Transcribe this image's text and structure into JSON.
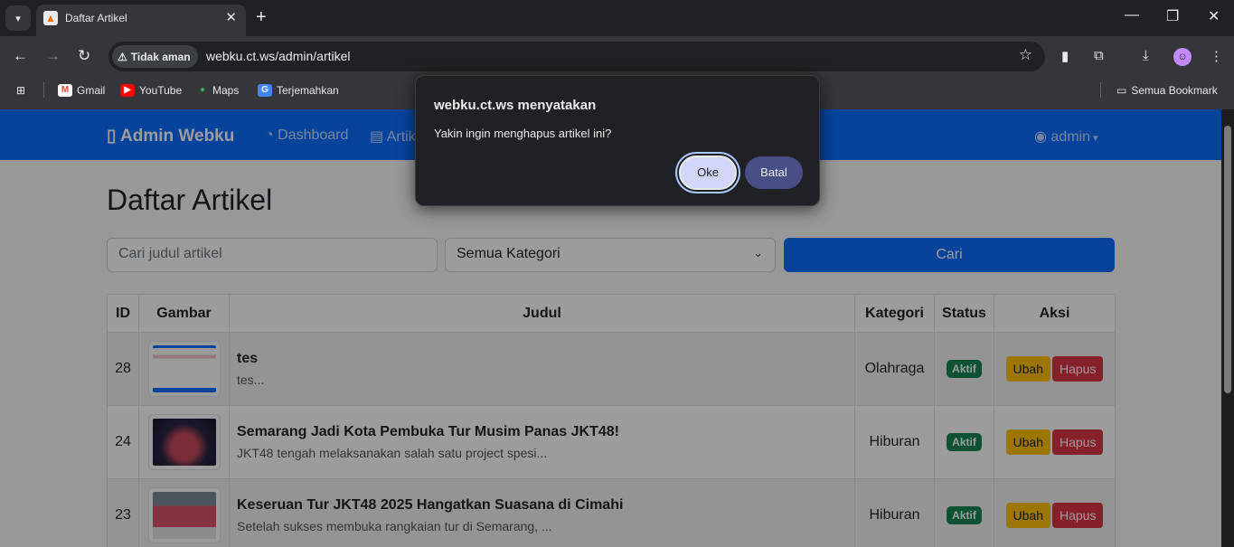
{
  "browser": {
    "tab_title": "Daftar Artikel",
    "security_label": "Tidak aman",
    "url": "webku.ct.ws/admin/artikel",
    "bookmarks": [
      "Gmail",
      "YouTube",
      "Maps",
      "Terjemahkan"
    ],
    "all_bookmarks": "Semua Bookmark"
  },
  "navbar": {
    "brand": "Admin Webku",
    "links": [
      "Dashboard",
      "Artik"
    ],
    "user": "admin"
  },
  "page": {
    "title": "Daftar Artikel",
    "search_placeholder": "Cari judul artikel",
    "category_selected": "Semua Kategori",
    "search_button": "Cari"
  },
  "table": {
    "headers": [
      "ID",
      "Gambar",
      "Judul",
      "Kategori",
      "Status",
      "Aksi"
    ],
    "rows": [
      {
        "id": "28",
        "title": "tes",
        "excerpt": "tes...",
        "category": "Olahraga",
        "status": "Aktif",
        "edit": "Ubah",
        "delete": "Hapus"
      },
      {
        "id": "24",
        "title": "Semarang Jadi Kota Pembuka Tur Musim Panas JKT48!",
        "excerpt": "JKT48 tengah melaksanakan salah satu project spesi...",
        "category": "Hiburan",
        "status": "Aktif",
        "edit": "Ubah",
        "delete": "Hapus"
      },
      {
        "id": "23",
        "title": "Keseruan Tur JKT48 2025 Hangatkan Suasana di Cimahi",
        "excerpt": "Setelah sukses membuka rangkaian tur di Semarang, ...",
        "category": "Hiburan",
        "status": "Aktif",
        "edit": "Ubah",
        "delete": "Hapus"
      }
    ]
  },
  "dialog": {
    "title": "webku.ct.ws menyatakan",
    "message": "Yakin ingin menghapus artikel ini?",
    "ok": "Oke",
    "cancel": "Batal"
  },
  "colors": {
    "primary": "#0d6efd",
    "success": "#198754",
    "warning": "#ffc107",
    "danger": "#dc3545"
  }
}
